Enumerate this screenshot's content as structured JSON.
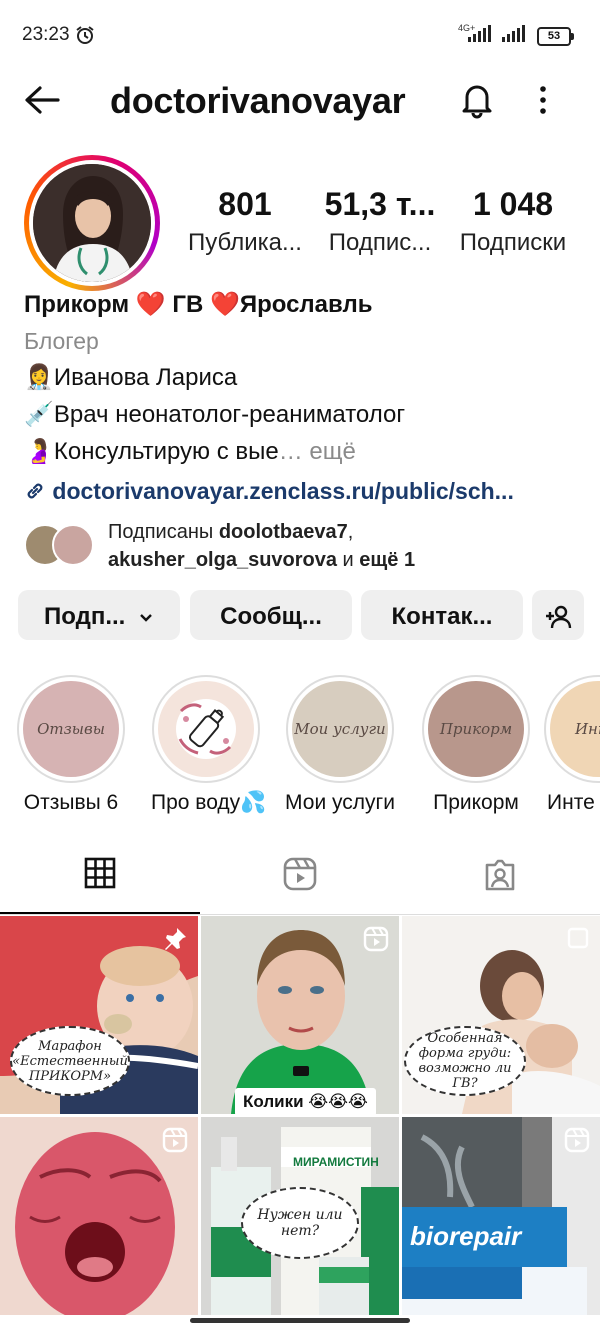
{
  "status_bar": {
    "time": "23:23",
    "network": "4G+",
    "battery": "53"
  },
  "header": {
    "handle": "doctorivanovayar",
    "back_icon": "arrow-left-icon",
    "bell_icon": "bell-icon",
    "menu_icon": "more-vertical-icon"
  },
  "stats": [
    {
      "value": "801",
      "label": "Публика..."
    },
    {
      "value": "51,3 т...",
      "label": "Подпис..."
    },
    {
      "value": "1 048",
      "label": "Подписки"
    }
  ],
  "bio": {
    "name": "Прикорм ❤️ ГВ ❤️Ярославль",
    "category": "Блогер",
    "line1": "👩‍⚕️Иванова Лариса",
    "line2": "💉Врач неонатолог-реаниматолог",
    "line3": "🤰Консультирую с вые",
    "more": "… ещё",
    "link": "doctorivanovayar.zenclass.ru/public/sch..."
  },
  "followed_by": {
    "prefix": "Подписаны ",
    "user1": "doolotbaeva7",
    "user2": "akusher_olga_suvorova",
    "and": " и ",
    "more": "ещё 1"
  },
  "buttons": {
    "follow": "Подп...",
    "message": "Сообщ...",
    "contact": "Контак...",
    "add_user_icon": "person-add-icon"
  },
  "highlights": [
    {
      "label": "Отзывы 6",
      "cover_text": "Отзывы",
      "color": "#d6b3b3"
    },
    {
      "label": "Про воду💦",
      "cover_text": "",
      "color": "#f4e4dc"
    },
    {
      "label": "Мои услуги",
      "cover_text": "Мои услуги",
      "color": "#d7cdbf"
    },
    {
      "label": "Прикорм",
      "cover_text": "Прикорм",
      "color": "#b8978c"
    },
    {
      "label": "Инте",
      "cover_text": "Инте",
      "color": "#f0d6b5"
    }
  ],
  "tabs": [
    {
      "icon": "grid-icon",
      "active": true
    },
    {
      "icon": "reels-icon",
      "active": false
    },
    {
      "icon": "tagged-icon",
      "active": false
    }
  ],
  "posts": [
    {
      "overlay": "Марафон «Естественный ПРИКОРМ»",
      "badge": "pin-icon"
    },
    {
      "overlay": "Колики 😭😭😭",
      "badge": "reel-icon"
    },
    {
      "overlay": "Особенная форма груди: возможно ли ГВ?",
      "badge": "carousel-icon"
    },
    {
      "overlay": "",
      "badge": "reel-icon"
    },
    {
      "overlay": "Нужен или нет?",
      "product": "МИРАМИСТИН",
      "badge": ""
    },
    {
      "overlay": "",
      "product": "biorepair",
      "badge": "reel-icon"
    }
  ]
}
